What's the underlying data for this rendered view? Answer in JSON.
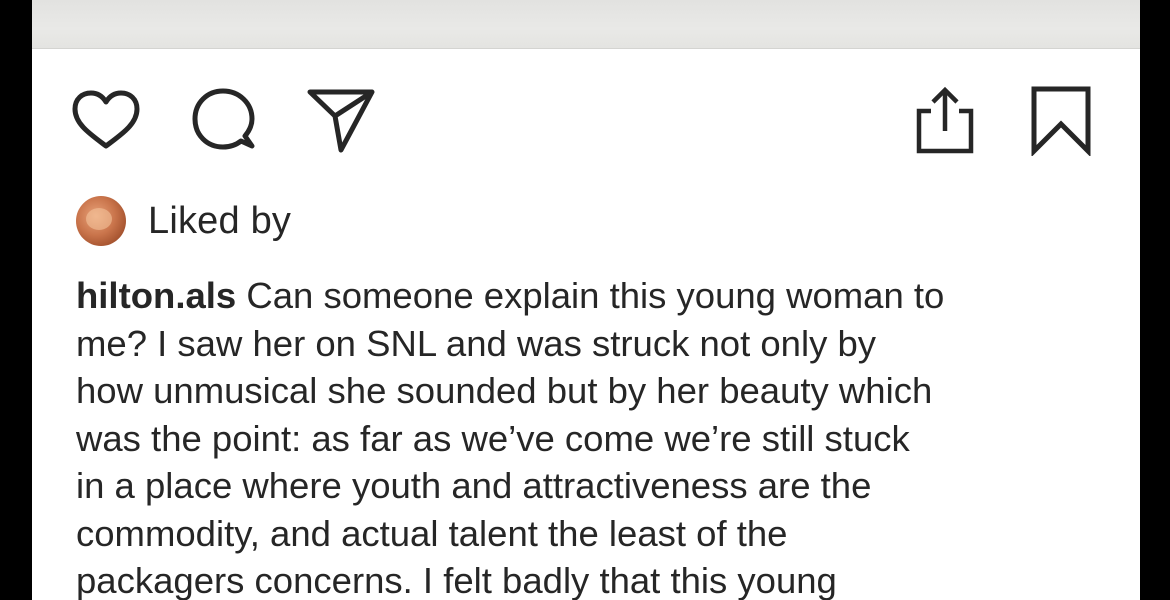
{
  "post": {
    "liked_by_label": "Liked by",
    "caption": {
      "username": "hilton.als",
      "lines": [
        "Can someone explain this young woman to",
        "me? I saw her on SNL and was struck not only by",
        "how unmusical she sounded but by her beauty which",
        "was the point: as far as we’ve come we’re still stuck",
        "in a place where youth and attractiveness are the",
        "commodity, and actual talent the least of the",
        "packagers concerns. I felt badly that this young"
      ]
    }
  },
  "actions": {
    "like_icon": "heart-icon",
    "comment_icon": "comment-icon",
    "share_icon": "send-icon",
    "export_icon": "share-export-icon",
    "save_icon": "bookmark-icon"
  },
  "colors": {
    "text": "#262626",
    "background": "#ffffff",
    "frame": "#000000"
  }
}
